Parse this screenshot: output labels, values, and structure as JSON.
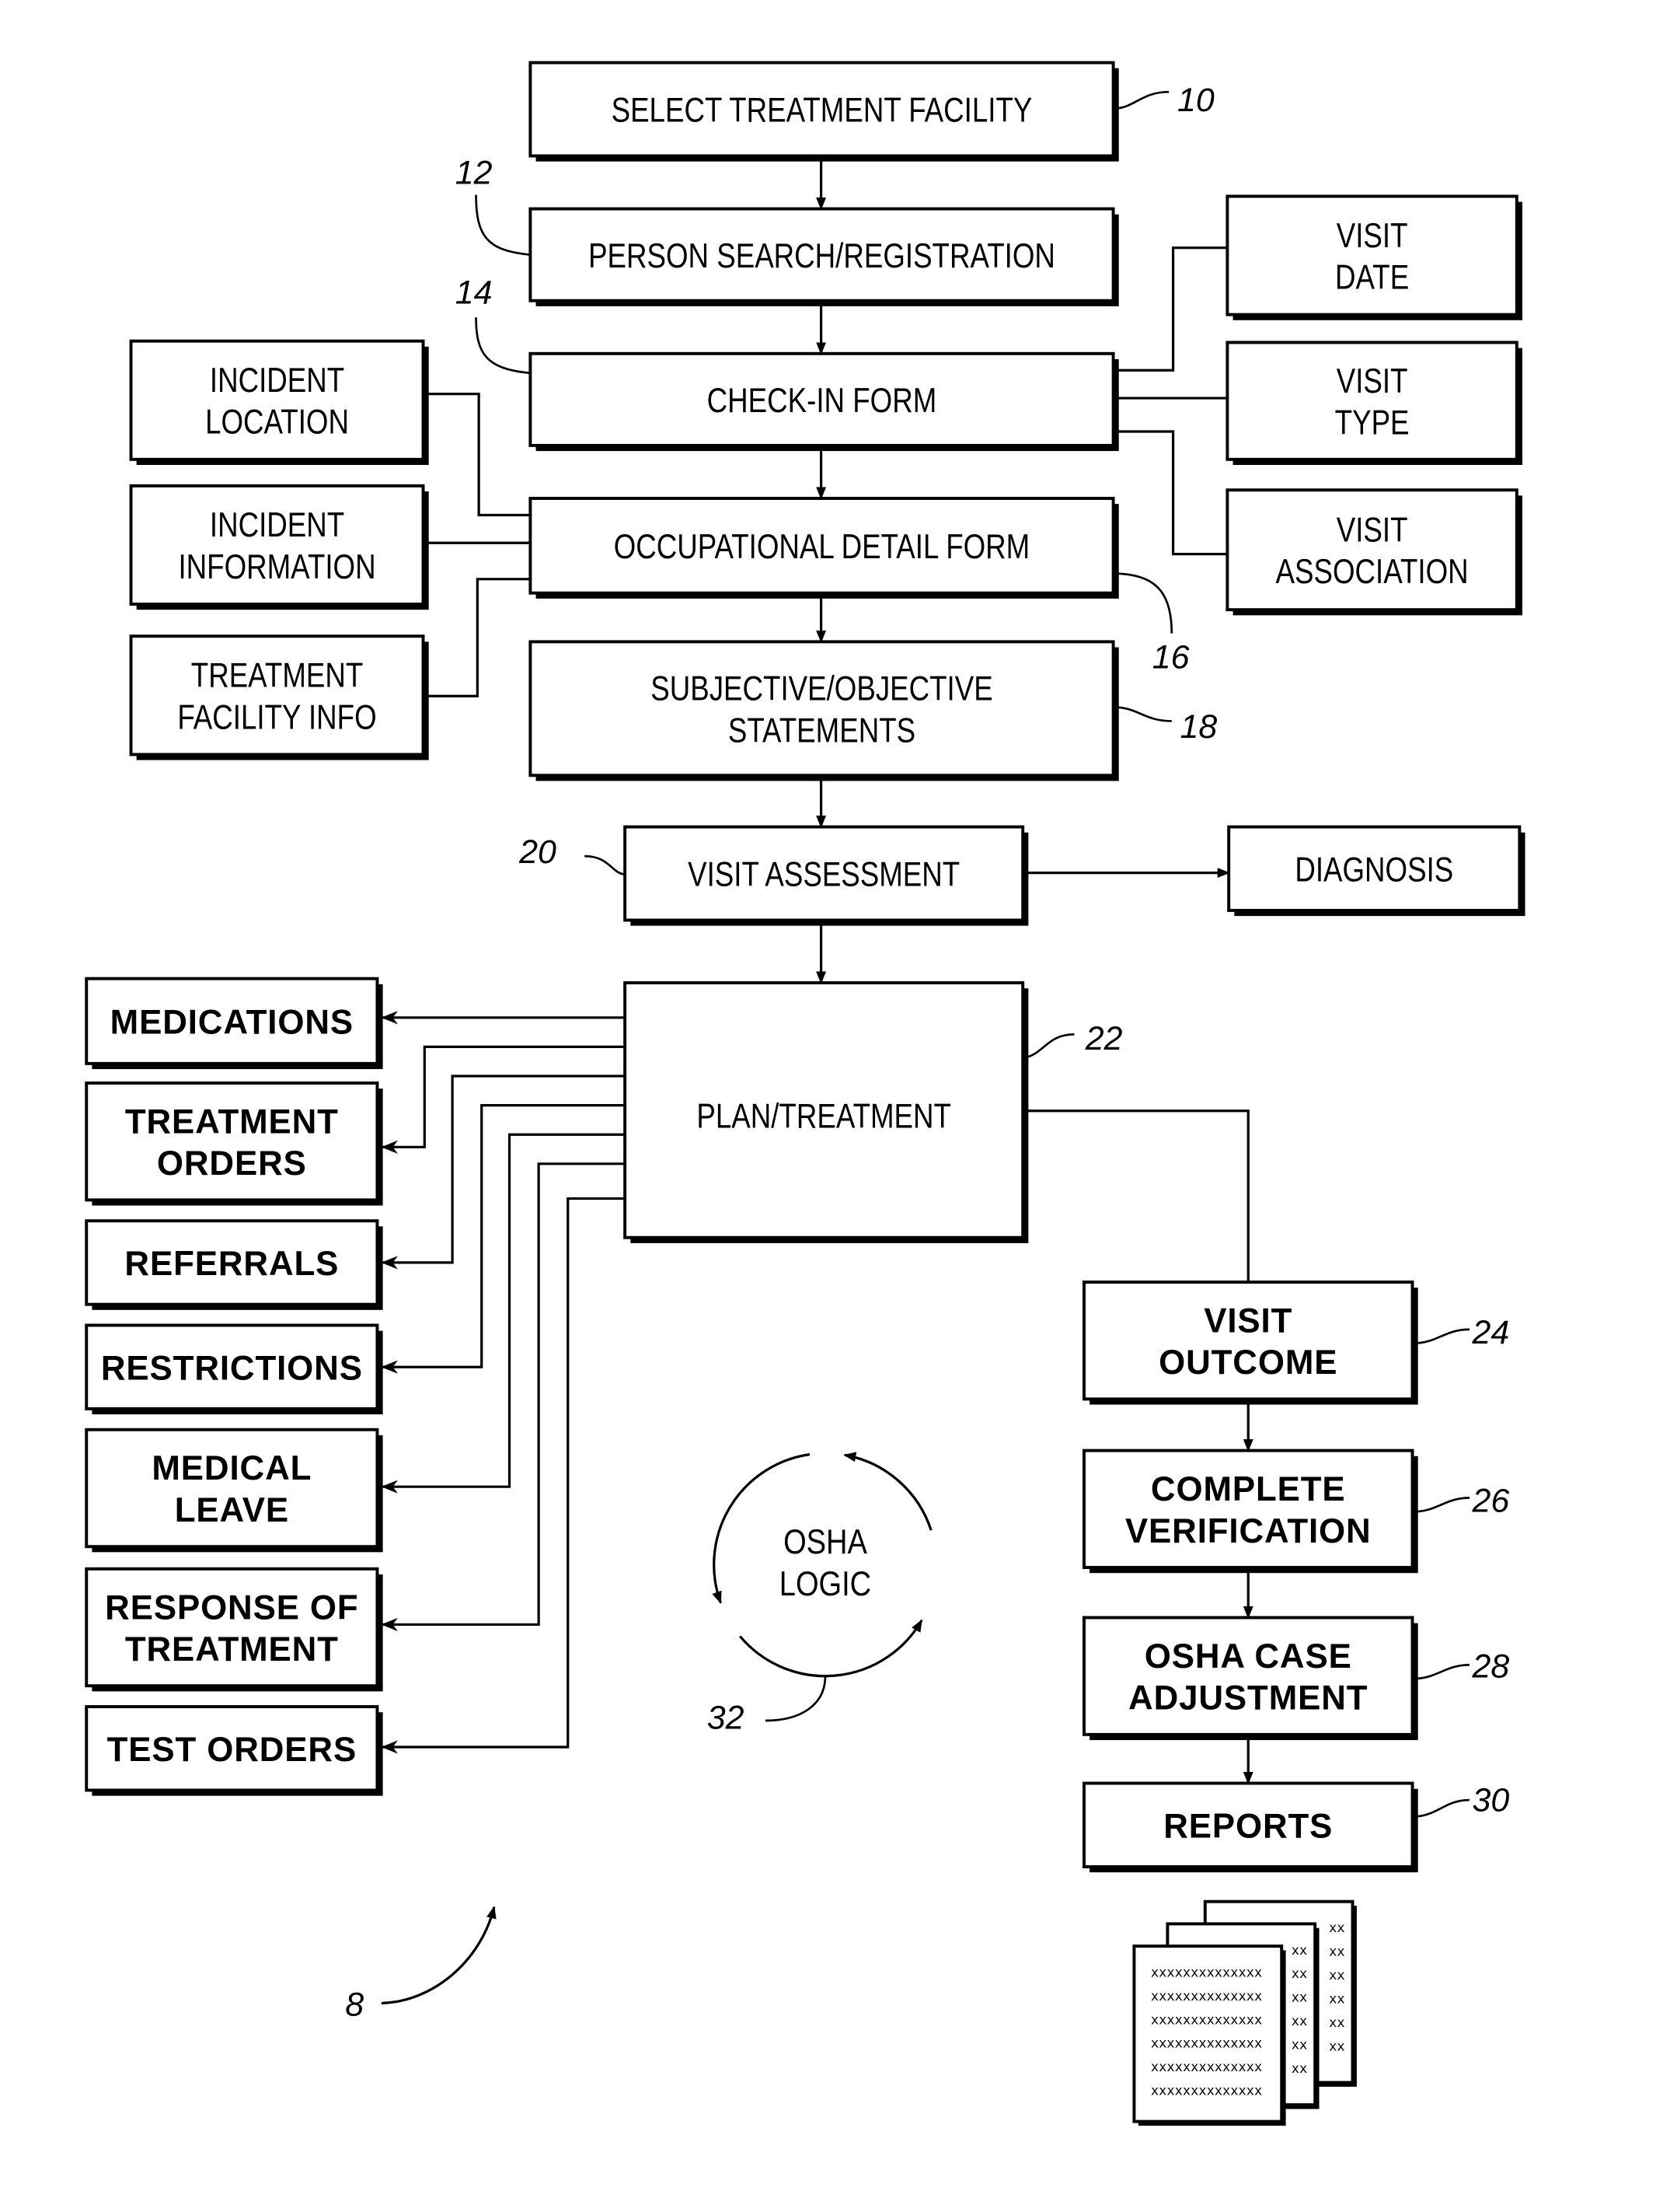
{
  "figure": {
    "reference_numeral": "8",
    "main_flow": [
      {
        "id": "select-treatment-facility",
        "lines": [
          "SELECT TREATMENT FACILITY"
        ],
        "ref": "10"
      },
      {
        "id": "person-search-registration",
        "lines": [
          "PERSON SEARCH/REGISTRATION"
        ],
        "ref": "12"
      },
      {
        "id": "check-in-form",
        "lines": [
          "CHECK-IN FORM"
        ],
        "ref": "14"
      },
      {
        "id": "occupational-detail-form",
        "lines": [
          "OCCUPATIONAL DETAIL FORM"
        ],
        "ref": "16"
      },
      {
        "id": "subjective-objective-statements",
        "lines": [
          "SUBJECTIVE/OBJECTIVE",
          "STATEMENTS"
        ],
        "ref": "18"
      },
      {
        "id": "visit-assessment",
        "lines": [
          "VISIT ASSESSMENT"
        ],
        "ref": "20"
      },
      {
        "id": "plan-treatment",
        "lines": [
          "PLAN/TREATMENT"
        ],
        "ref": "22"
      }
    ],
    "check_in_details": [
      {
        "id": "visit-date",
        "lines": [
          "VISIT",
          "DATE"
        ]
      },
      {
        "id": "visit-type",
        "lines": [
          "VISIT",
          "TYPE"
        ]
      },
      {
        "id": "visit-association",
        "lines": [
          "VISIT",
          "ASSOCIATION"
        ]
      }
    ],
    "occupational_inputs": [
      {
        "id": "incident-location",
        "lines": [
          "INCIDENT",
          "LOCATION"
        ]
      },
      {
        "id": "incident-information",
        "lines": [
          "INCIDENT",
          "INFORMATION"
        ]
      },
      {
        "id": "treatment-facility-info",
        "lines": [
          "TREATMENT",
          "FACILITY INFO"
        ]
      }
    ],
    "assessment_output": {
      "id": "diagnosis",
      "lines": [
        "DIAGNOSIS"
      ]
    },
    "plan_outputs": [
      {
        "id": "medications",
        "lines": [
          "MEDICATIONS"
        ]
      },
      {
        "id": "treatment-orders",
        "lines": [
          "TREATMENT",
          "ORDERS"
        ]
      },
      {
        "id": "referrals",
        "lines": [
          "REFERRALS"
        ]
      },
      {
        "id": "restrictions",
        "lines": [
          "RESTRICTIONS"
        ]
      },
      {
        "id": "medical-leave",
        "lines": [
          "MEDICAL",
          "LEAVE"
        ]
      },
      {
        "id": "response-of-treatment",
        "lines": [
          "RESPONSE OF",
          "TREATMENT"
        ]
      },
      {
        "id": "test-orders",
        "lines": [
          "TEST ORDERS"
        ]
      }
    ],
    "outcome_flow": [
      {
        "id": "visit-outcome",
        "lines": [
          "VISIT",
          "OUTCOME"
        ],
        "ref": "24"
      },
      {
        "id": "complete-verification",
        "lines": [
          "COMPLETE",
          "VERIFICATION"
        ],
        "ref": "26"
      },
      {
        "id": "osha-case-adjustment",
        "lines": [
          "OSHA CASE",
          "ADJUSTMENT"
        ],
        "ref": "28"
      },
      {
        "id": "reports",
        "lines": [
          "REPORTS"
        ],
        "ref": "30"
      }
    ],
    "osha_logic": {
      "lines": [
        "OSHA",
        "LOGIC"
      ],
      "ref": "32"
    },
    "report_document_line": "xxxxxxxxxxxxxx",
    "report_document_edge": "xx"
  }
}
